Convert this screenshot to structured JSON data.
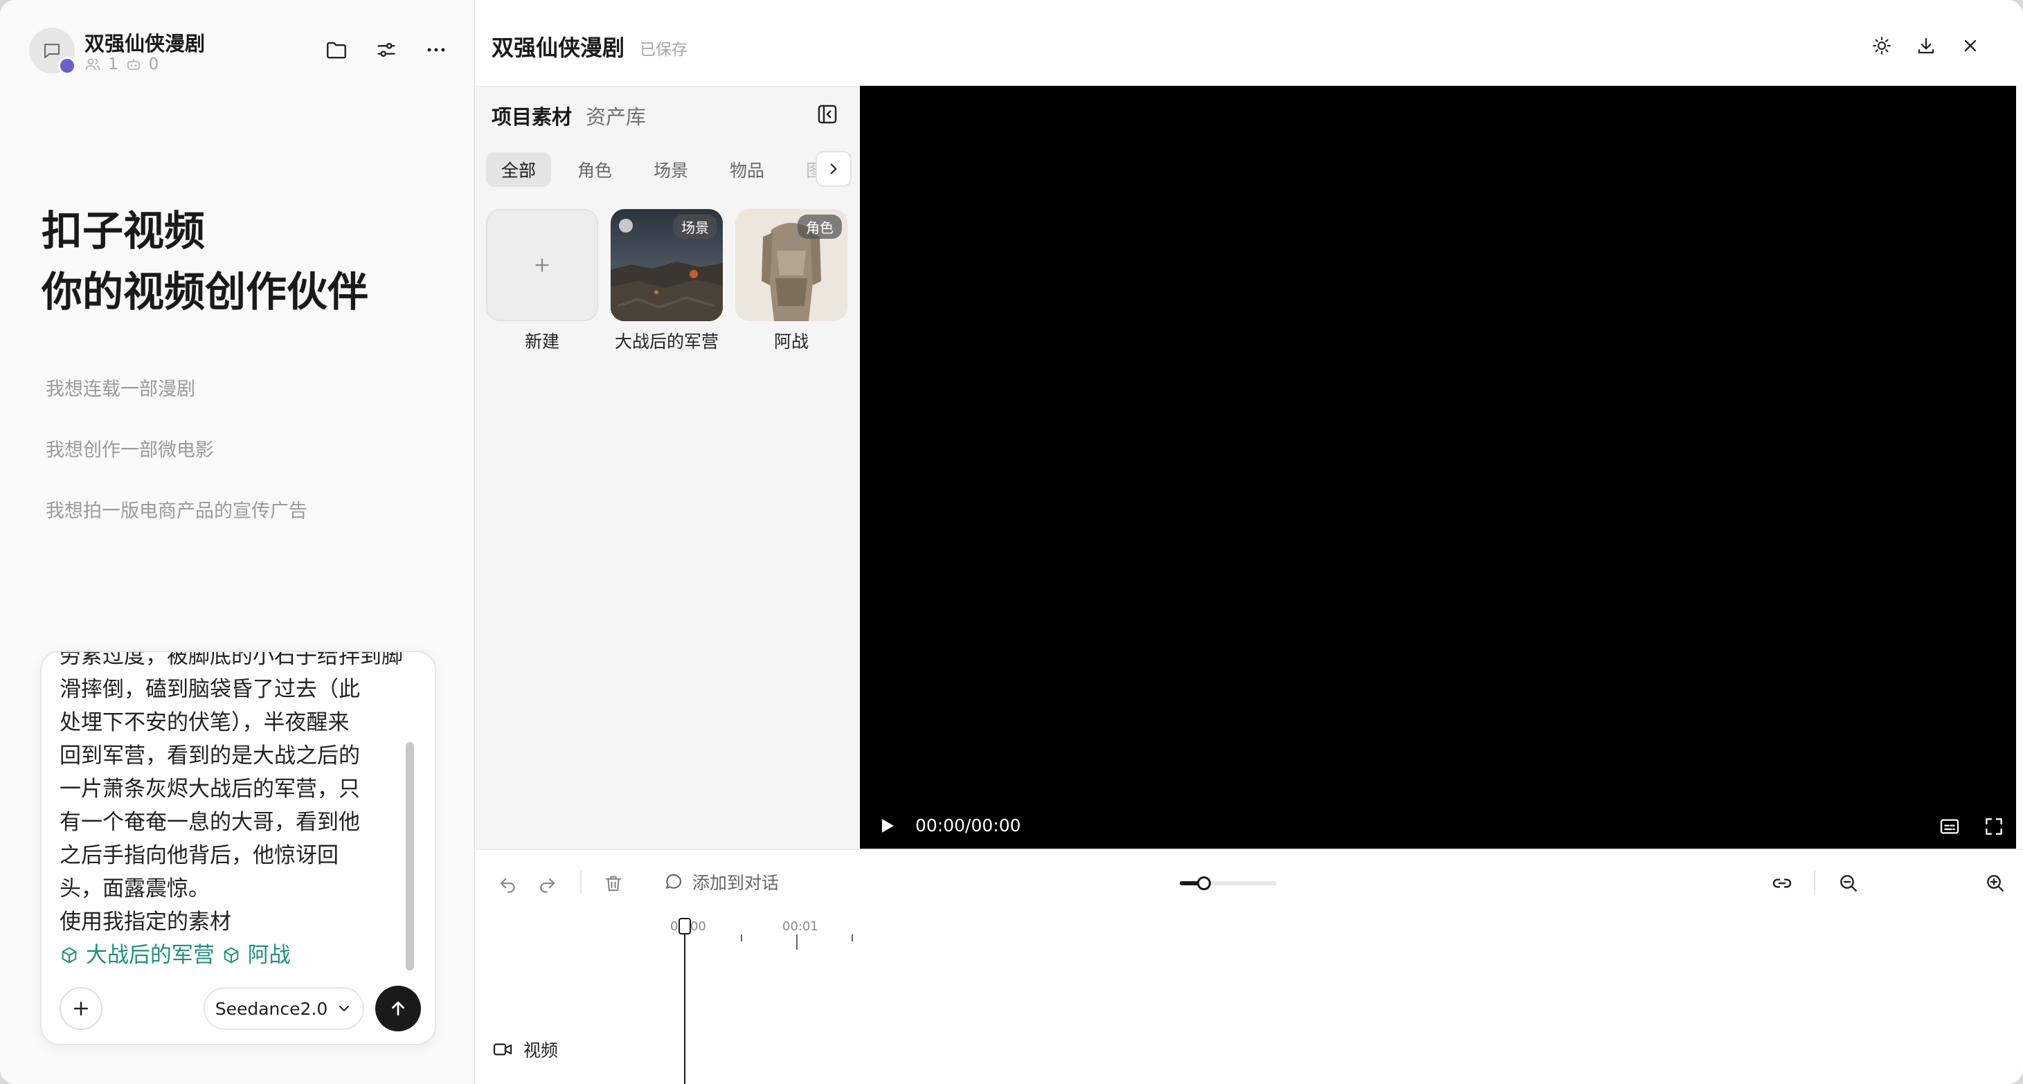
{
  "sidebar": {
    "project_name": "双强仙侠漫剧",
    "members_count": "1",
    "bots_count": "0",
    "hero_line1": "扣子视频",
    "hero_line2": "你的视频创作伙伴",
    "suggestions": [
      "我想连载一部漫剧",
      "我想创作一部微电影",
      "我想拍一版电商产品的宣传广告"
    ]
  },
  "composer": {
    "lines": [
      "劳累过度，被脚底的小石子给拌到脚",
      "滑摔倒，磕到脑袋昏了过去（此",
      "处埋下不安的伏笔），半夜醒来",
      "回到军营，看到的是大战之后的",
      "一片萧条灰烬大战后的军营，只",
      "有一个奄奄一息的大哥，看到他",
      "之后手指向他背后，他惊讶回",
      "头，面露震惊。",
      "使用我指定的素材"
    ],
    "asset_refs": [
      "大战后的军营",
      "阿战"
    ],
    "model": "Seedance2.0"
  },
  "topbar": {
    "title": "双强仙侠漫剧",
    "saved_status": "已保存"
  },
  "assets": {
    "tab_active": "项目素材",
    "tab_library": "资产库",
    "filters": [
      "全部",
      "角色",
      "场景",
      "物品",
      "图片"
    ],
    "cards": [
      {
        "label": "新建",
        "badge": ""
      },
      {
        "label": "大战后的军营",
        "badge": "场景"
      },
      {
        "label": "阿战",
        "badge": "角色"
      }
    ]
  },
  "player": {
    "time": "00:00/00:00"
  },
  "timeline": {
    "add_to_chat": "添加到对话",
    "ruler": [
      "00:00",
      "00:01"
    ],
    "track_label": "视频",
    "zoom_level": 0.25
  },
  "colors": {
    "accent_teal": "#1f8f7a",
    "dark": "#1a1a1a"
  }
}
